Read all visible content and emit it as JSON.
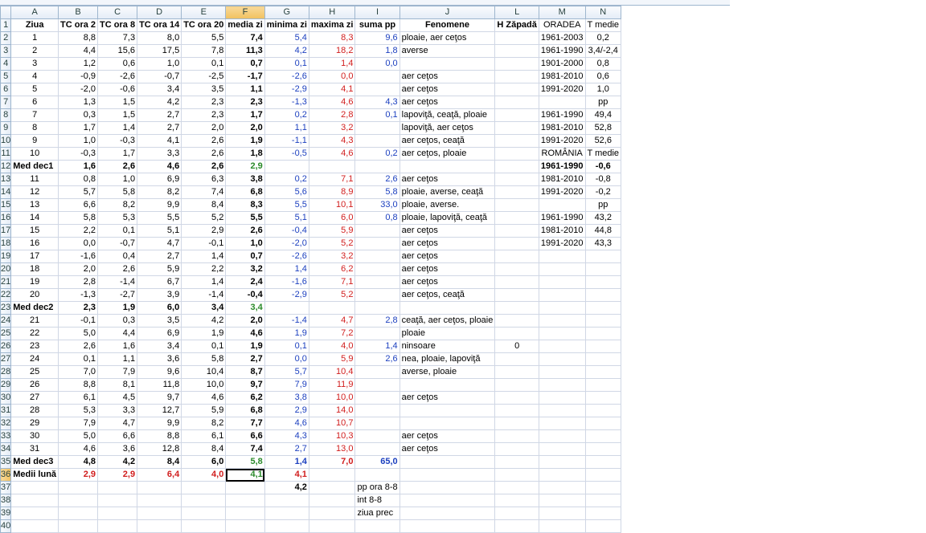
{
  "columns": [
    "A",
    "B",
    "C",
    "D",
    "E",
    "F",
    "G",
    "H",
    "I",
    "J",
    "L",
    "M",
    "N"
  ],
  "rows": [
    {
      "n": "1",
      "A": "Ziua",
      "B": "TC ora 2",
      "C": "TC ora 8",
      "D": "TC ora 14",
      "E": "TC ora 20",
      "F": "media zi",
      "G": "minima zi",
      "H": "maxima zi",
      "I": "suma pp",
      "J": "Fenomene",
      "L": "H Zăpadă",
      "M": "ORADEA",
      "N": "T medie"
    },
    {
      "n": "2",
      "A": "1",
      "B": "8,8",
      "C": "7,3",
      "D": "8,0",
      "E": "5,5",
      "F": "7,4",
      "G": "5,4",
      "H": "8,3",
      "I": "9,6",
      "J": "ploaie, aer ceţos",
      "M": "1961-2003",
      "N": "0,2"
    },
    {
      "n": "3",
      "A": "2",
      "B": "4,4",
      "C": "15,6",
      "D": "17,5",
      "E": "7,8",
      "F": "11,3",
      "G": "4,2",
      "H": "18,2",
      "I": "1,8",
      "J": "averse",
      "M": "1961-1990",
      "N": "3,4/-2,4"
    },
    {
      "n": "4",
      "A": "3",
      "B": "1,2",
      "C": "0,6",
      "D": "1,0",
      "E": "0,1",
      "F": "0,7",
      "G": "0,1",
      "H": "1,4",
      "I": "0,0",
      "M": "1901-2000",
      "N": "0,8"
    },
    {
      "n": "5",
      "A": "4",
      "B": "-0,9",
      "C": "-2,6",
      "D": "-0,7",
      "E": "-2,5",
      "F": "-1,7",
      "G": "-2,6",
      "H": "0,0",
      "J": "aer ceţos",
      "M": "1981-2010",
      "N": "0,6"
    },
    {
      "n": "6",
      "A": "5",
      "B": "-2,0",
      "C": "-0,6",
      "D": "3,4",
      "E": "3,5",
      "F": "1,1",
      "G": "-2,9",
      "H": "4,1",
      "J": "aer ceţos",
      "M": "1991-2020",
      "N": "1,0"
    },
    {
      "n": "7",
      "A": "6",
      "B": "1,3",
      "C": "1,5",
      "D": "4,2",
      "E": "2,3",
      "F": "2,3",
      "G": "-1,3",
      "H": "4,6",
      "I": "4,3",
      "J": "aer ceţos",
      "N": "pp"
    },
    {
      "n": "8",
      "A": "7",
      "B": "0,3",
      "C": "1,5",
      "D": "2,7",
      "E": "2,3",
      "F": "1,7",
      "G": "0,2",
      "H": "2,8",
      "I": "0,1",
      "J": "lapoviţă, ceaţă, ploaie",
      "M": "1961-1990",
      "N": "49,4"
    },
    {
      "n": "9",
      "A": "8",
      "B": "1,7",
      "C": "1,4",
      "D": "2,7",
      "E": "2,0",
      "F": "2,0",
      "G": "1,1",
      "H": "3,2",
      "J": "lapoviţă, aer ceţos",
      "M": "1981-2010",
      "N": "52,8"
    },
    {
      "n": "10",
      "A": "9",
      "B": "1,0",
      "C": "-0,3",
      "D": "4,1",
      "E": "2,6",
      "F": "1,9",
      "G": "-1,1",
      "H": "4,3",
      "J": "aer ceţos, ceaţă",
      "M": "1991-2020",
      "N": "52,6"
    },
    {
      "n": "11",
      "A": "10",
      "B": "-0,3",
      "C": "1,7",
      "D": "3,3",
      "E": "2,6",
      "F": "1,8",
      "G": "-0,5",
      "H": "4,6",
      "I": "0,2",
      "J": "aer ceţos, ploaie",
      "M": "ROMÂNIA",
      "N": "T medie"
    },
    {
      "n": "12",
      "A": "Med dec1",
      "B": "1,6",
      "C": "2,6",
      "D": "4,6",
      "E": "2,6",
      "F": "2,9",
      "M": "1961-1990",
      "N": "-0,6"
    },
    {
      "n": "13",
      "A": "11",
      "B": "0,8",
      "C": "1,0",
      "D": "6,9",
      "E": "6,3",
      "F": "3,8",
      "G": "0,2",
      "H": "7,1",
      "I": "2,6",
      "J": "aer ceţos",
      "M": "1981-2010",
      "N": "-0,8"
    },
    {
      "n": "14",
      "A": "12",
      "B": "5,7",
      "C": "5,8",
      "D": "8,2",
      "E": "7,4",
      "F": "6,8",
      "G": "5,6",
      "H": "8,9",
      "I": "5,8",
      "J": "ploaie, averse, ceaţă",
      "M": "1991-2020",
      "N": "-0,2"
    },
    {
      "n": "15",
      "A": "13",
      "B": "6,6",
      "C": "8,2",
      "D": "9,9",
      "E": "8,4",
      "F": "8,3",
      "G": "5,5",
      "H": "10,1",
      "I": "33,0",
      "J": "ploaie, averse.",
      "N": "pp"
    },
    {
      "n": "16",
      "A": "14",
      "B": "5,8",
      "C": "5,3",
      "D": "5,5",
      "E": "5,2",
      "F": "5,5",
      "G": "5,1",
      "H": "6,0",
      "I": "0,8",
      "J": "ploaie, lapoviţă, ceaţă",
      "M": "1961-1990",
      "N": "43,2"
    },
    {
      "n": "17",
      "A": "15",
      "B": "2,2",
      "C": "0,1",
      "D": "5,1",
      "E": "2,9",
      "F": "2,6",
      "G": "-0,4",
      "H": "5,9",
      "J": "aer ceţos",
      "M": "1981-2010",
      "N": "44,8"
    },
    {
      "n": "18",
      "A": "16",
      "B": "0,0",
      "C": "-0,7",
      "D": "4,7",
      "E": "-0,1",
      "F": "1,0",
      "G": "-2,0",
      "H": "5,2",
      "J": "aer ceţos",
      "M": "1991-2020",
      "N": "43,3"
    },
    {
      "n": "19",
      "A": "17",
      "B": "-1,6",
      "C": "0,4",
      "D": "2,7",
      "E": "1,4",
      "F": "0,7",
      "G": "-2,6",
      "H": "3,2",
      "J": "aer ceţos"
    },
    {
      "n": "20",
      "A": "18",
      "B": "2,0",
      "C": "2,6",
      "D": "5,9",
      "E": "2,2",
      "F": "3,2",
      "G": "1,4",
      "H": "6,2",
      "J": "aer ceţos"
    },
    {
      "n": "21",
      "A": "19",
      "B": "2,8",
      "C": "-1,4",
      "D": "6,7",
      "E": "1,4",
      "F": "2,4",
      "G": "-1,6",
      "H": "7,1",
      "J": "aer ceţos"
    },
    {
      "n": "22",
      "A": "20",
      "B": "-1,3",
      "C": "-2,7",
      "D": "3,9",
      "E": "-1,4",
      "F": "-0,4",
      "G": "-2,9",
      "H": "5,2",
      "J": "aer ceţos, ceaţă"
    },
    {
      "n": "23",
      "A": "Med dec2",
      "B": "2,3",
      "C": "1,9",
      "D": "6,0",
      "E": "3,4",
      "F": "3,4"
    },
    {
      "n": "24",
      "A": "21",
      "B": "-0,1",
      "C": "0,3",
      "D": "3,5",
      "E": "4,2",
      "F": "2,0",
      "G": "-1,4",
      "H": "4,7",
      "I": "2,8",
      "J": "ceaţă, aer ceţos, ploaie"
    },
    {
      "n": "25",
      "A": "22",
      "B": "5,0",
      "C": "4,4",
      "D": "6,9",
      "E": "1,9",
      "F": "4,6",
      "G": "1,9",
      "H": "7,2",
      "J": "ploaie"
    },
    {
      "n": "26",
      "A": "23",
      "B": "2,6",
      "C": "1,6",
      "D": "3,4",
      "E": "0,1",
      "F": "1,9",
      "G": "0,1",
      "H": "4,0",
      "I": "1,4",
      "J": "ninsoare",
      "L": "0"
    },
    {
      "n": "27",
      "A": "24",
      "B": "0,1",
      "C": "1,1",
      "D": "3,6",
      "E": "5,8",
      "F": "2,7",
      "G": "0,0",
      "H": "5,9",
      "I": "2,6",
      "J": "nea, ploaie, lapoviţă"
    },
    {
      "n": "28",
      "A": "25",
      "B": "7,0",
      "C": "7,9",
      "D": "9,6",
      "E": "10,4",
      "F": "8,7",
      "G": "5,7",
      "H": "10,4",
      "J": "averse, ploaie"
    },
    {
      "n": "29",
      "A": "26",
      "B": "8,8",
      "C": "8,1",
      "D": "11,8",
      "E": "10,0",
      "F": "9,7",
      "G": "7,9",
      "H": "11,9"
    },
    {
      "n": "30",
      "A": "27",
      "B": "6,1",
      "C": "4,5",
      "D": "9,7",
      "E": "4,6",
      "F": "6,2",
      "G": "3,8",
      "H": "10,0",
      "J": "aer ceţos"
    },
    {
      "n": "31",
      "A": "28",
      "B": "5,3",
      "C": "3,3",
      "D": "12,7",
      "E": "5,9",
      "F": "6,8",
      "G": "2,9",
      "H": "14,0"
    },
    {
      "n": "32",
      "A": "29",
      "B": "7,9",
      "C": "4,7",
      "D": "9,9",
      "E": "8,2",
      "F": "7,7",
      "G": "4,6",
      "H": "10,7"
    },
    {
      "n": "33",
      "A": "30",
      "B": "5,0",
      "C": "6,6",
      "D": "8,8",
      "E": "6,1",
      "F": "6,6",
      "G": "4,3",
      "H": "10,3",
      "J": "aer ceţos"
    },
    {
      "n": "34",
      "A": "31",
      "B": "4,6",
      "C": "3,6",
      "D": "12,8",
      "E": "8,4",
      "F": "7,4",
      "G": "2,7",
      "H": "13,0",
      "J": "aer ceţos"
    },
    {
      "n": "35",
      "A": "Med dec3",
      "B": "4,8",
      "C": "4,2",
      "D": "8,4",
      "E": "6,0",
      "F": "5,8",
      "G": "1,4",
      "H": "7,0",
      "I": "65,0"
    },
    {
      "n": "36",
      "A": "Medii lună",
      "B": "2,9",
      "C": "2,9",
      "D": "6,4",
      "E": "4,0",
      "F": "4,1",
      "G": "4,1"
    },
    {
      "n": "37",
      "G": "4,2",
      "I": "pp ora 8-8"
    },
    {
      "n": "38",
      "I": "int 8-8"
    },
    {
      "n": "39",
      "I": "ziua prec"
    },
    {
      "n": "40"
    }
  ],
  "selection": {
    "cell": "F36",
    "row": "36",
    "column": "F"
  },
  "colors": {
    "blue": "#1b3fbf",
    "red": "#d11d1d",
    "green": "#2a8a2a",
    "header_bg": "#e4ecf7",
    "selected_header": "#f1c15f"
  }
}
